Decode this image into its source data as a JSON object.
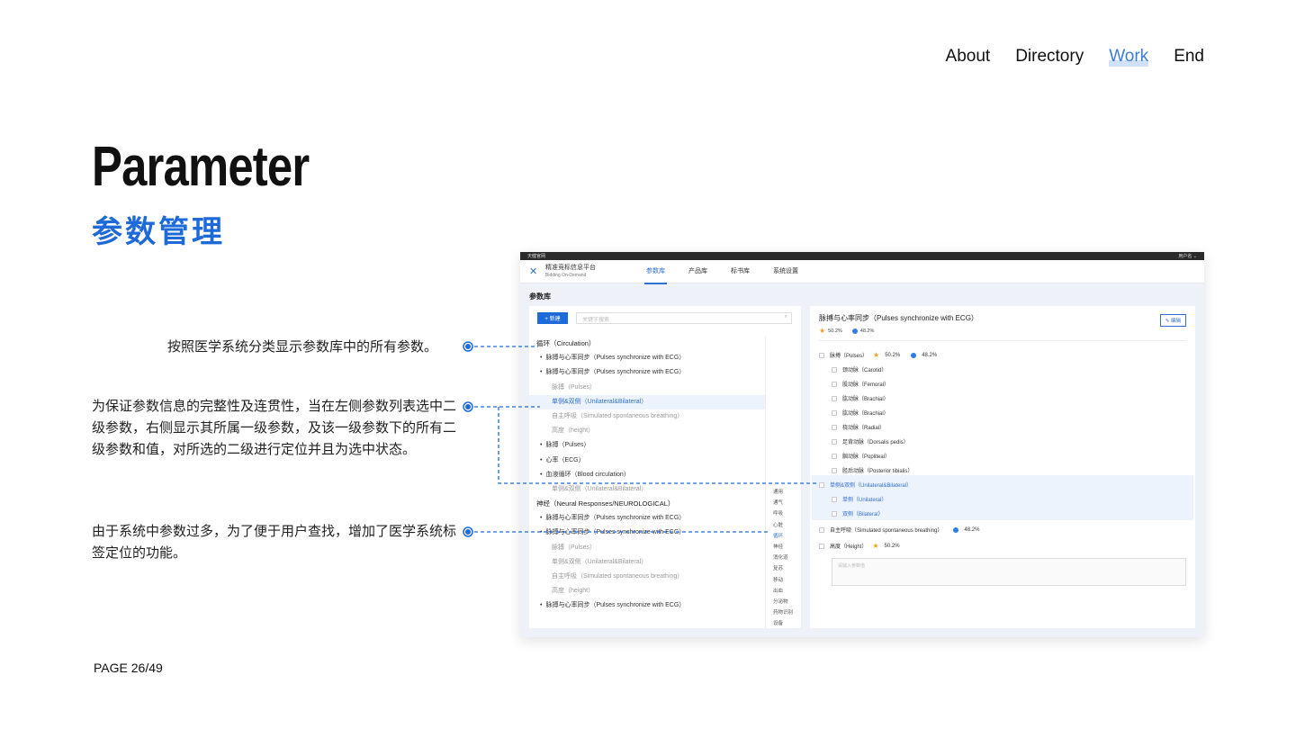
{
  "nav": {
    "items": [
      "About",
      "Directory",
      "Work",
      "End"
    ],
    "active": "Work"
  },
  "title_en": "Parameter",
  "title_cn": "参数管理",
  "notes": [
    "按照医学系统分类显示参数库中的所有参数。",
    "为保证参数信息的完整性及连贯性，当在左侧参数列表选中二级参数，右侧显示其所属一级参数，及该一级参数下的所有二级参数和值，对所选的二级进行定位并且为选中状态。",
    "由于系统中参数过多，为了便于用户查找，增加了医学系统标签定位的功能。"
  ],
  "page": "PAGE 26/49",
  "colors": {
    "accent": "#1e6ad8",
    "nav_active": "#3b7ddd",
    "star": "#f0a023"
  },
  "app": {
    "top_left": "天健官网",
    "top_right": "用户名 ⌄",
    "logo_title": "精准竞标信息平台",
    "logo_sub": "Bidding On-Demand",
    "tabs": [
      "参数库",
      "产品库",
      "标书库",
      "系统设置"
    ],
    "breadcrumb": "参数库",
    "new_button": "+ 新建",
    "search_placeholder": "关键字搜索",
    "tree": [
      {
        "level": 1,
        "text": "循环（Circulation）"
      },
      {
        "level": 2,
        "text": "脉搏与心率同步（Pulses synchronize with ECG）"
      },
      {
        "level": 2,
        "text": "脉搏与心率同步（Pulses synchronize with ECG）"
      },
      {
        "level": 3,
        "text": "脉搏（Pulses）"
      },
      {
        "level": 3,
        "text": "单侧&双侧（Unilateral&Bilateral）",
        "selected": true
      },
      {
        "level": 3,
        "text": "自主呼吸（Simulated spontaneous breathing）"
      },
      {
        "level": 3,
        "text": "高度（height）"
      },
      {
        "level": 2,
        "text": "脉搏（Pulses）"
      },
      {
        "level": 2,
        "text": "心率（ECG）"
      },
      {
        "level": 2,
        "text": "血液循环（Blood circulation）"
      },
      {
        "level": 3,
        "text": "单侧&双侧（Unilateral&Bilateral）"
      },
      {
        "level": 1,
        "text": "神经（Neural Responses/NEUROLOGICAL）"
      },
      {
        "level": 2,
        "text": "脉搏与心率同步（Pulses synchronize with ECG）"
      },
      {
        "level": 2,
        "text": "脉搏与心率同步（Pulses synchronize with ECG）"
      },
      {
        "level": 3,
        "text": "脉搏（Pulses）"
      },
      {
        "level": 3,
        "text": "单侧&双侧（Unilateral&Bilateral）"
      },
      {
        "level": 3,
        "text": "自主呼吸（Simulated spontaneous breathing）"
      },
      {
        "level": 3,
        "text": "高度（height）"
      },
      {
        "level": 2,
        "text": "脉搏与心率同步（Pulses synchronize with ECG）"
      }
    ],
    "systems": [
      "通用",
      "通气",
      "呼吸",
      "心脏",
      "循环",
      "神经",
      "消化道",
      "复苏",
      "移动",
      "出血",
      "分泌物",
      "药物识别",
      "设备"
    ],
    "systems_active": "循环",
    "detail": {
      "title": "脉搏与心率同步（Pulses synchronize with ECG）",
      "edit": "编辑",
      "star_pct": "50.2%",
      "dot_pct": "48.2%",
      "rows": [
        {
          "text": "脉搏（Pulses）",
          "indent": 0,
          "star": "50.2%",
          "dot": "48.2%"
        },
        {
          "text": "颈动脉（Carotid）",
          "indent": 1
        },
        {
          "text": "股动脉（Femoral）",
          "indent": 1
        },
        {
          "text": "肱动脉（Brachial）",
          "indent": 1
        },
        {
          "text": "肱动脉（Brachial）",
          "indent": 1
        },
        {
          "text": "桡动脉（Radial）",
          "indent": 1
        },
        {
          "text": "足背动脉（Dorsalis pedis）",
          "indent": 1
        },
        {
          "text": "腘动脉（Popliteal）",
          "indent": 1
        },
        {
          "text": "胫后动脉（Posterior tibialis）",
          "indent": 1
        },
        {
          "text": "单侧&双侧（Unilateral&Bilateral）",
          "indent": 0,
          "selected": true
        },
        {
          "text": "单侧（Unilateral）",
          "indent": 1,
          "selected": true
        },
        {
          "text": "双侧（Bilateral）",
          "indent": 1,
          "selected": true
        },
        {
          "text": "自主呼吸（Simulated spontaneous breathing）",
          "indent": 0,
          "dot": "48.2%"
        },
        {
          "text": "高度（Height）",
          "indent": 0,
          "star": "50.2%"
        }
      ],
      "textarea_placeholder": "请输入参数值"
    }
  }
}
